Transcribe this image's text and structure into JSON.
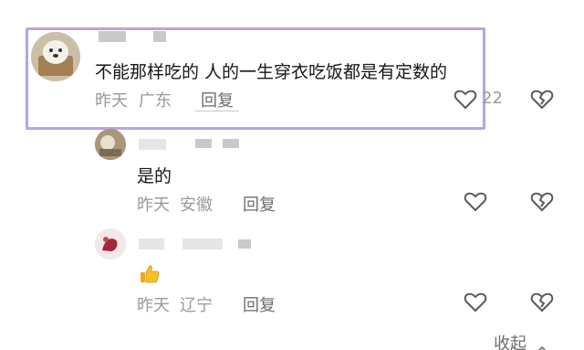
{
  "comments": [
    {
      "text": "不能那样吃的 人的一生穿衣吃饭都是有定数的",
      "time": "昨天",
      "location": "广东",
      "reply_label": "回复",
      "like_count": "22",
      "highlighted": true
    }
  ],
  "replies": [
    {
      "text": "是的",
      "time": "昨天",
      "location": "安徽",
      "reply_label": "回复"
    },
    {
      "emoji": "thumbs-up-emoji",
      "time": "昨天",
      "location": "辽宁",
      "reply_label": "回复"
    }
  ],
  "collapse_label": "收起",
  "colors": {
    "highlight_border": "#b9a3e6",
    "meta_text": "#9a9a9a",
    "reply_text": "#6e6e6e"
  }
}
